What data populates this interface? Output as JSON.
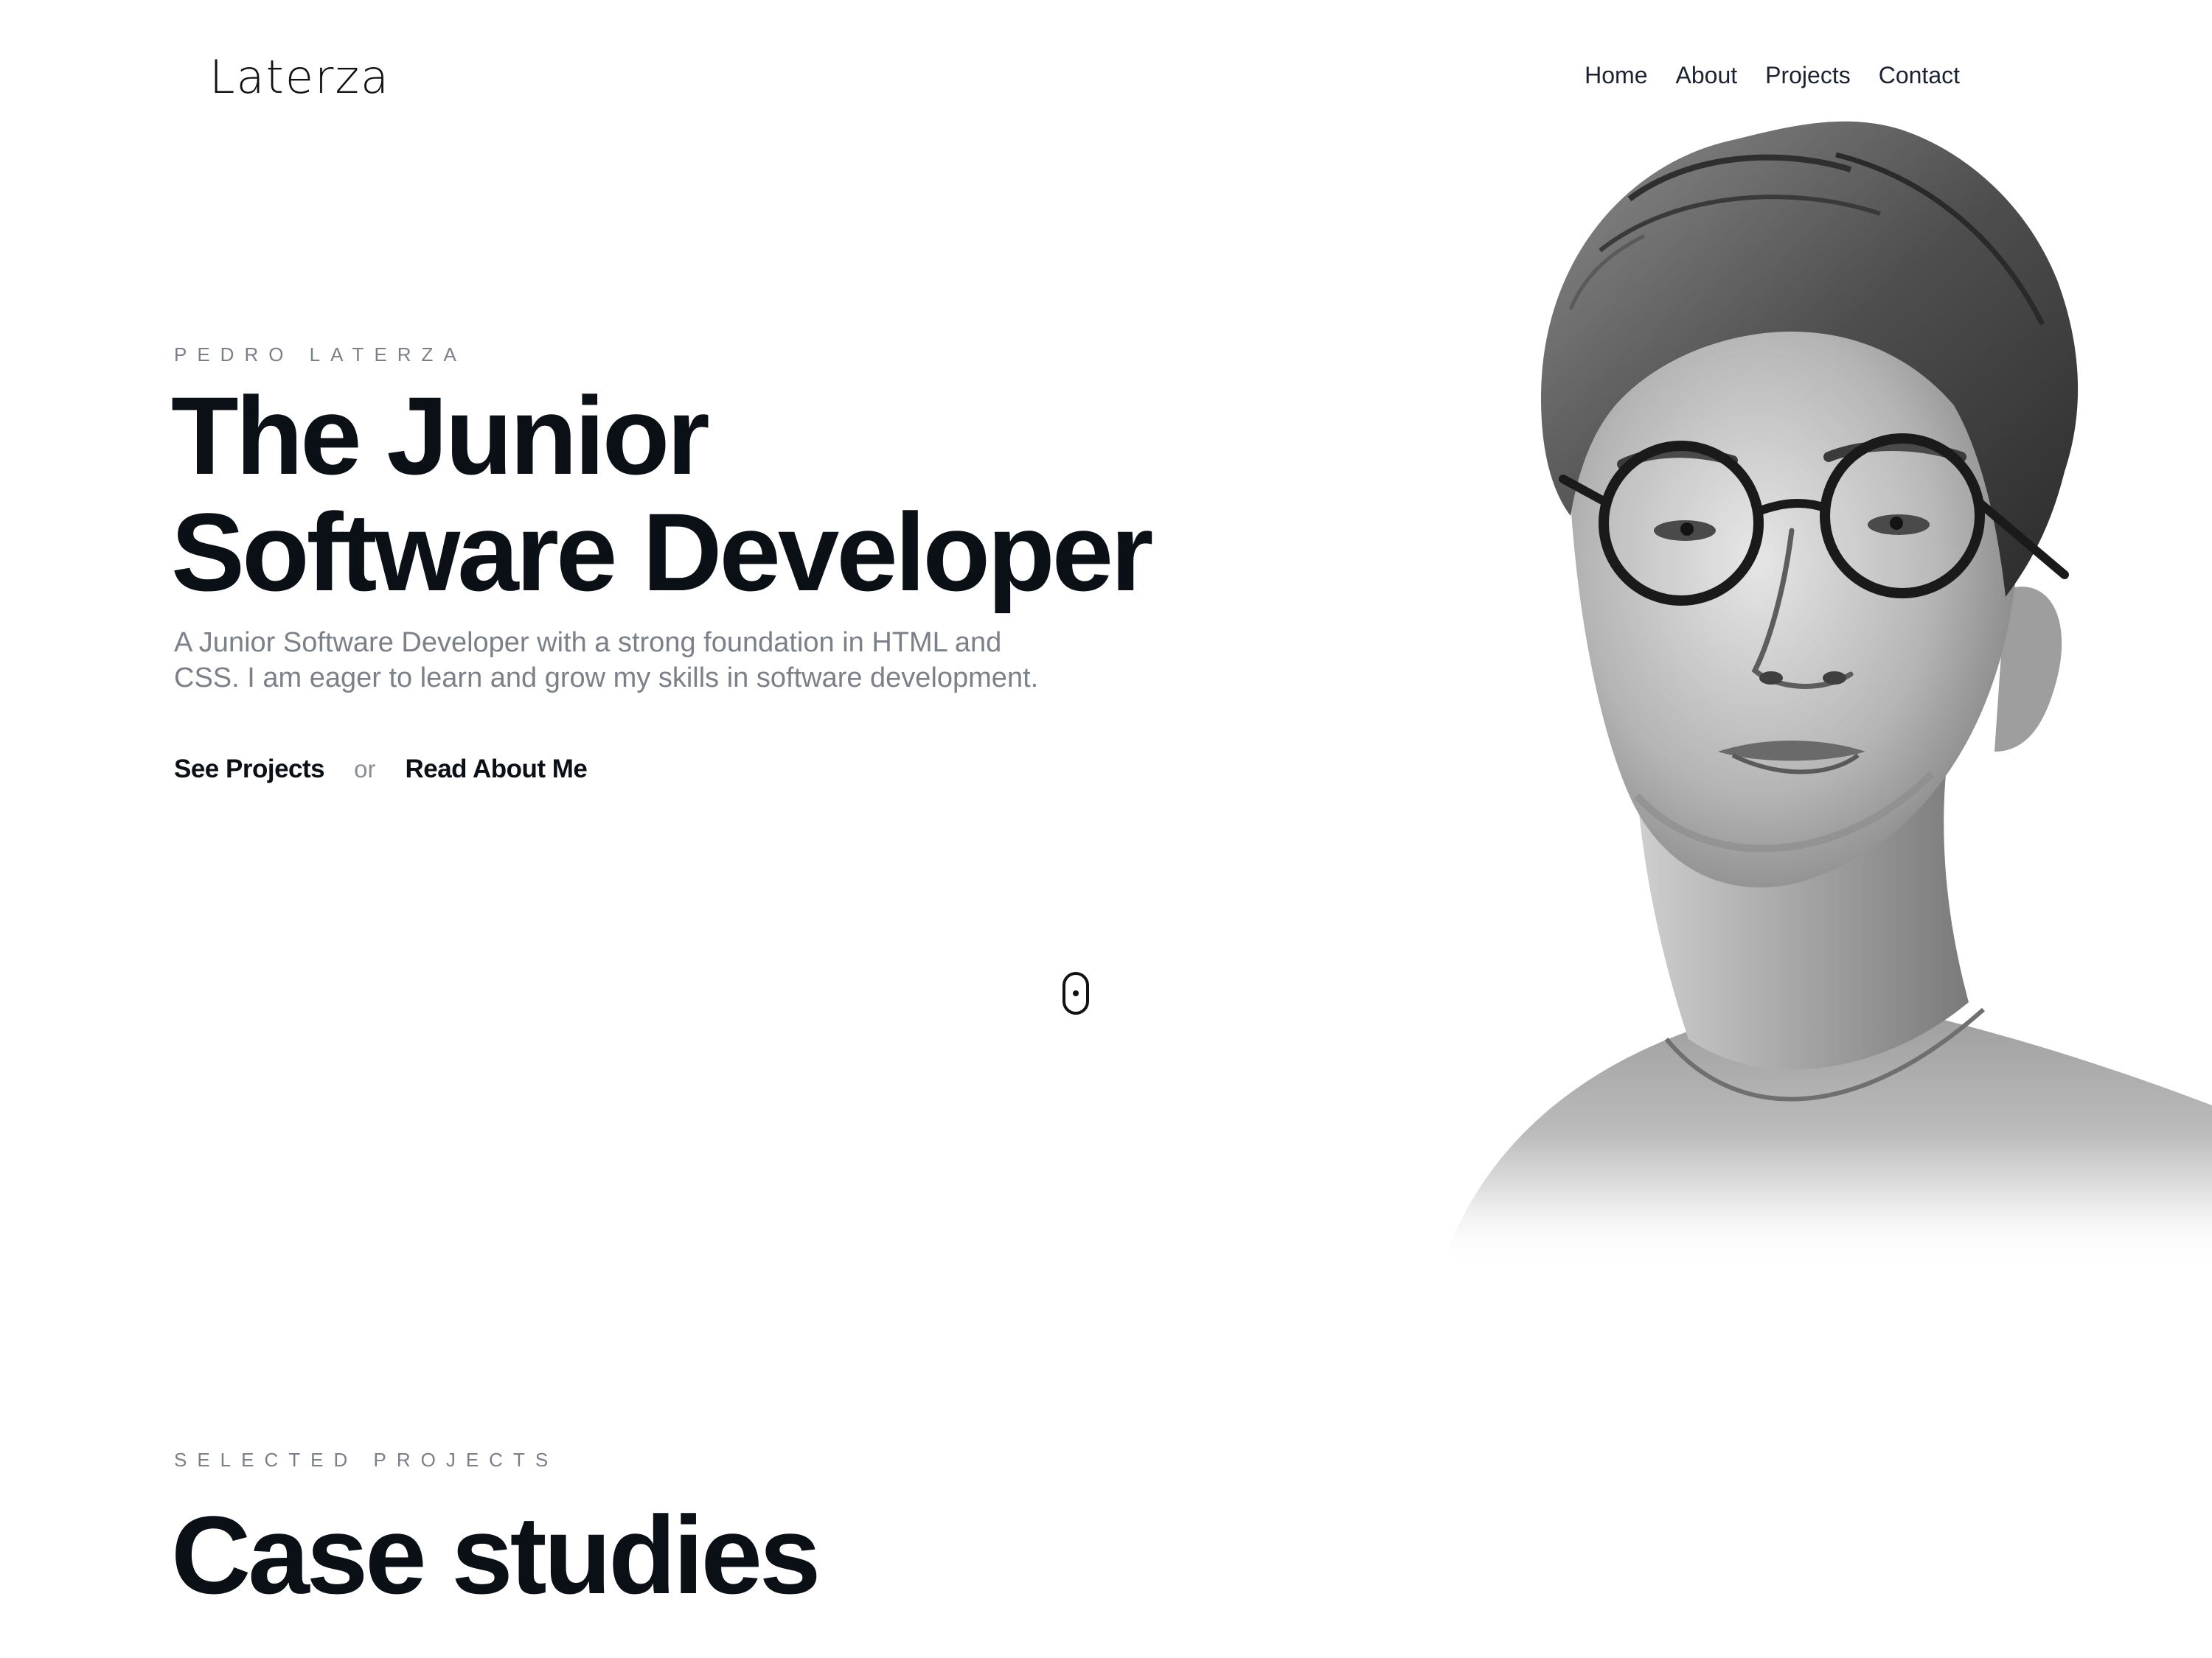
{
  "header": {
    "logo_text": "Laterza",
    "nav": [
      {
        "label": "Home"
      },
      {
        "label": "About"
      },
      {
        "label": "Projects"
      },
      {
        "label": "Contact"
      }
    ]
  },
  "hero": {
    "eyebrow": "PEDRO LATERZA",
    "title_line1": "The Junior",
    "title_line2": "Software Developer",
    "description": "A Junior Software Developer with a strong foundation in HTML and CSS. I am eager to learn and grow my skills in software development.",
    "cta_primary": "See Projects",
    "cta_separator": "or",
    "cta_secondary": "Read About Me",
    "scroll_icon": "mouse-scroll-icon",
    "portrait_icon": "portrait-illustration"
  },
  "projects_section": {
    "eyebrow": "SELECTED PROJECTS",
    "title": "Case studies"
  },
  "colors": {
    "text_primary": "#0b0f16",
    "text_muted": "#7c8088",
    "background": "#ffffff"
  }
}
